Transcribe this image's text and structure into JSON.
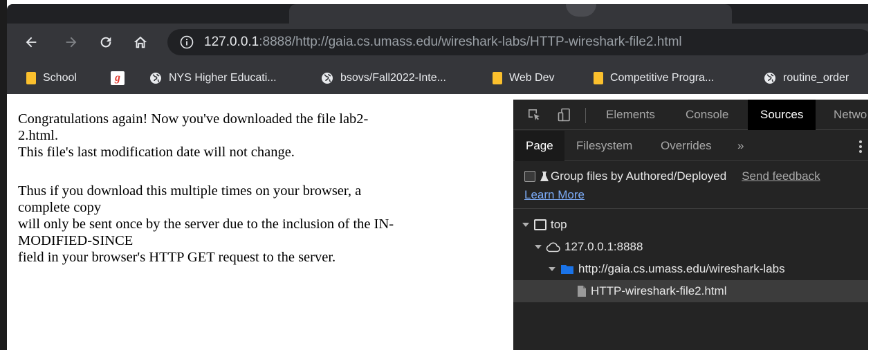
{
  "browser": {
    "address": {
      "host": "127.0.0.1",
      "rest": ":8888/http://gaia.cs.umass.edu/wireshark-labs/HTTP-wireshark-file2.html"
    },
    "nav_icons": [
      "back-arrow-icon",
      "forward-arrow-icon",
      "reload-icon",
      "home-icon",
      "info-icon"
    ],
    "bookmarks": [
      {
        "label": "School",
        "icon": "folder-icon"
      },
      {
        "label": "NYS Higher Educati...",
        "icon": "globe-icon"
      },
      {
        "label": "bsovs/Fall2022-Inte...",
        "icon": "globe-icon"
      },
      {
        "label": "Web Dev",
        "icon": "folder-icon"
      },
      {
        "label": "Competitive Progra...",
        "icon": "folder-icon"
      },
      {
        "label": "routine_order",
        "icon": "globe-icon"
      }
    ],
    "colors": {
      "bookmark_folder": "#fbc02d",
      "toolbar": "#35363a",
      "omnibox": "#202124"
    }
  },
  "page": {
    "lines": [
      "Congratulations again! Now you've downloaded the file lab2-",
      "2.html.",
      "This file's last modification date will not change.",
      "Thus if you download this multiple times on your browser, a",
      "complete copy",
      "will only be sent once by the server due to the inclusion of the IN-",
      "MODIFIED-SINCE",
      "field in your browser's HTTP GET request to the server."
    ]
  },
  "devtools": {
    "tabs": [
      "Elements",
      "Console",
      "Sources",
      "Netwo"
    ],
    "active_tab": "Sources",
    "subtabs": [
      "Page",
      "Filesystem",
      "Overrides",
      "»"
    ],
    "active_subtab": "Page",
    "group_files_label": "Group files by Authored/Deployed",
    "group_files_checked": false,
    "send_feedback": "Send feedback",
    "learn_more": "Learn More",
    "tree": [
      {
        "label": "top",
        "icon": "frame-icon"
      },
      {
        "label": "127.0.0.1:8888",
        "icon": "cloud-icon"
      },
      {
        "label": "http://gaia.cs.umass.edu/wireshark-labs",
        "icon": "folder-icon"
      },
      {
        "label": "HTTP-wireshark-file2.html",
        "icon": "file-icon",
        "selected": true
      }
    ],
    "colors": {
      "background": "#242424",
      "active_tab": "#000000",
      "link": "#7cacf8",
      "folder": "#1a73e8"
    }
  }
}
